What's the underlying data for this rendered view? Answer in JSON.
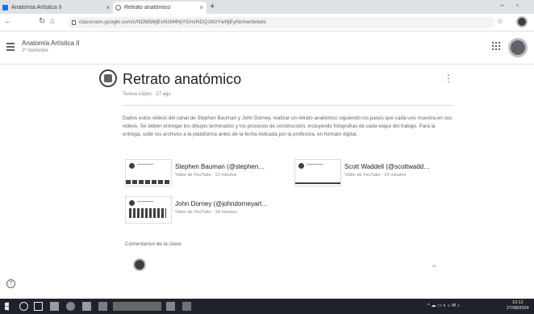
{
  "browser": {
    "tabs": [
      {
        "title": "Anatomía Artística II"
      },
      {
        "title": "Retrato anatómico"
      }
    ],
    "url": "classroom.google.com/c/NDM5MjExNzM4NjY5/m/NDQ1MzYwNjEyNzAw/details"
  },
  "course": {
    "name": "Anatomía Artística II",
    "section": "2º Semestre"
  },
  "post": {
    "title": "Retrato anatómico",
    "meta": "Teresa López · 27 ago",
    "body": "Dados estos videos del canal de Stephen Bauman y John Dorney, realizar un retrato anatómico siguiendo los pasos que cada uno muestra en sus videos. Se deben entregar los dibujos terminados y los procesos de construcción, incluyendo fotografías de cada etapa del trabajo. Para la entrega, subir los archivos a la plataforma antes de la fecha indicada por la profesora, en formato digital."
  },
  "attachments": [
    {
      "title": "Stephen Bauman (@stephen…",
      "subtitle": "Video de YouTube · 12 minutos"
    },
    {
      "title": "Scott Waddell (@scottwadd…",
      "subtitle": "Video de YouTube · 23 minutos"
    },
    {
      "title": "John Dorney (@johndorneyart…",
      "subtitle": "Video de YouTube · 18 minutos"
    }
  ],
  "comments": {
    "label": "Comentarios de la clase"
  },
  "taskbar": {
    "time": "13:12",
    "date": "27/08/2024"
  }
}
